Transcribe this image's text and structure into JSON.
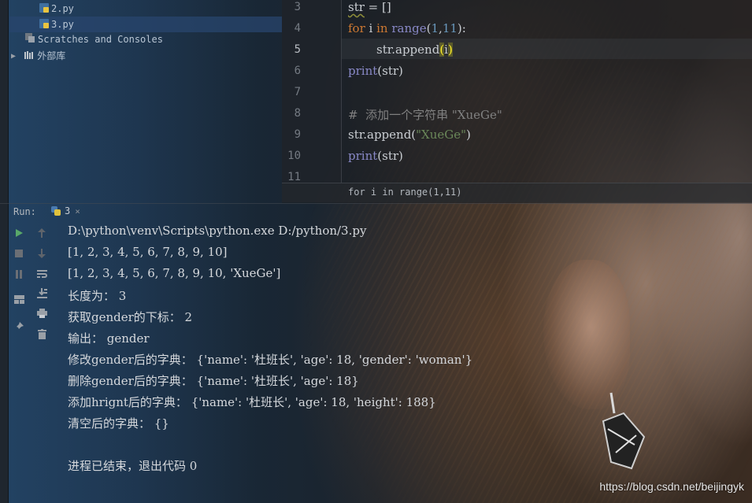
{
  "project_tree": {
    "items": [
      {
        "label": "2.py",
        "icon": "python-file-icon",
        "selected": false
      },
      {
        "label": "3.py",
        "icon": "python-file-icon",
        "selected": true
      },
      {
        "label": "Scratches and Consoles",
        "icon": "scratches-icon",
        "selected": false
      },
      {
        "label": "外部库",
        "icon": "library-icon",
        "selected": false
      }
    ]
  },
  "editor": {
    "line_numbers": [
      "3",
      "4",
      "5",
      "6",
      "7",
      "8",
      "9",
      "10",
      "11"
    ],
    "active_line": "5",
    "lines": {
      "l3_var": "str",
      "l3_rest": " = []",
      "l4_for": "for",
      "l4_i": " i ",
      "l4_in": "in",
      "l4_sp": " ",
      "l4_range": "range",
      "l4_open": "(",
      "l4_a": "1",
      "l4_comma": ",",
      "l4_b": "11",
      "l4_close": "):",
      "l5_call": "str.append",
      "l5_open": "(",
      "l5_arg": "i",
      "l5_close": ")",
      "l6_print": "print",
      "l6_args": "(str)",
      "l8_comment": "#  添加一个字符串 \"XueGe\"",
      "l9_call": "str.append(",
      "l9_str": "\"XueGe\"",
      "l9_close": ")",
      "l10_print": "print",
      "l10_args": "(str)"
    },
    "breadcrumb": "for i in range(1,11)"
  },
  "run_panel": {
    "label": "Run:",
    "tab_label": "3",
    "tab_close": "×"
  },
  "console": {
    "lines": [
      "D:\\python\\venv\\Scripts\\python.exe D:/python/3.py",
      "[1, 2, 3, 4, 5, 6, 7, 8, 9, 10]",
      "[1, 2, 3, 4, 5, 6, 7, 8, 9, 10, 'XueGe']",
      "长度为： 3",
      "获取gender的下标： 2",
      "输出： gender",
      "修改gender后的字典： {'name': '杜班长', 'age': 18, 'gender': 'woman'}",
      "删除gender后的字典： {'name': '杜班长', 'age': 18}",
      "添加hrignt后的字典： {'name': '杜班长', 'age': 18, 'height': 188}",
      "清空后的字典： {}",
      "",
      "进程已结束，退出代码 0"
    ]
  },
  "watermark": "https://blog.csdn.net/beijingyk",
  "colors": {
    "keyword": "#cc7832",
    "builtin": "#8888c6",
    "number": "#6897bb",
    "string": "#6a8759",
    "comment": "#808080",
    "run_green": "#59a869"
  }
}
